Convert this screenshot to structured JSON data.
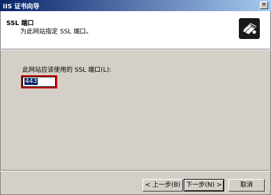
{
  "window": {
    "title": "IIS 证书向导",
    "close_label": "×"
  },
  "header": {
    "title": "SSL 端口",
    "subtitle": "为此网站指定 SSL 端口。",
    "icon": "certificate-icon"
  },
  "form": {
    "port_label": "此网站应该使用的 SSL 端口(L):",
    "port_value": "443"
  },
  "buttons": {
    "back": "< 上一步(B)",
    "next": "下一步(N) >",
    "cancel": "取消"
  },
  "colors": {
    "titlebar_start": "#0a246a",
    "titlebar_end": "#a6caf0",
    "highlight_border": "#d00000",
    "dialog_bg": "#d4d0c8"
  }
}
